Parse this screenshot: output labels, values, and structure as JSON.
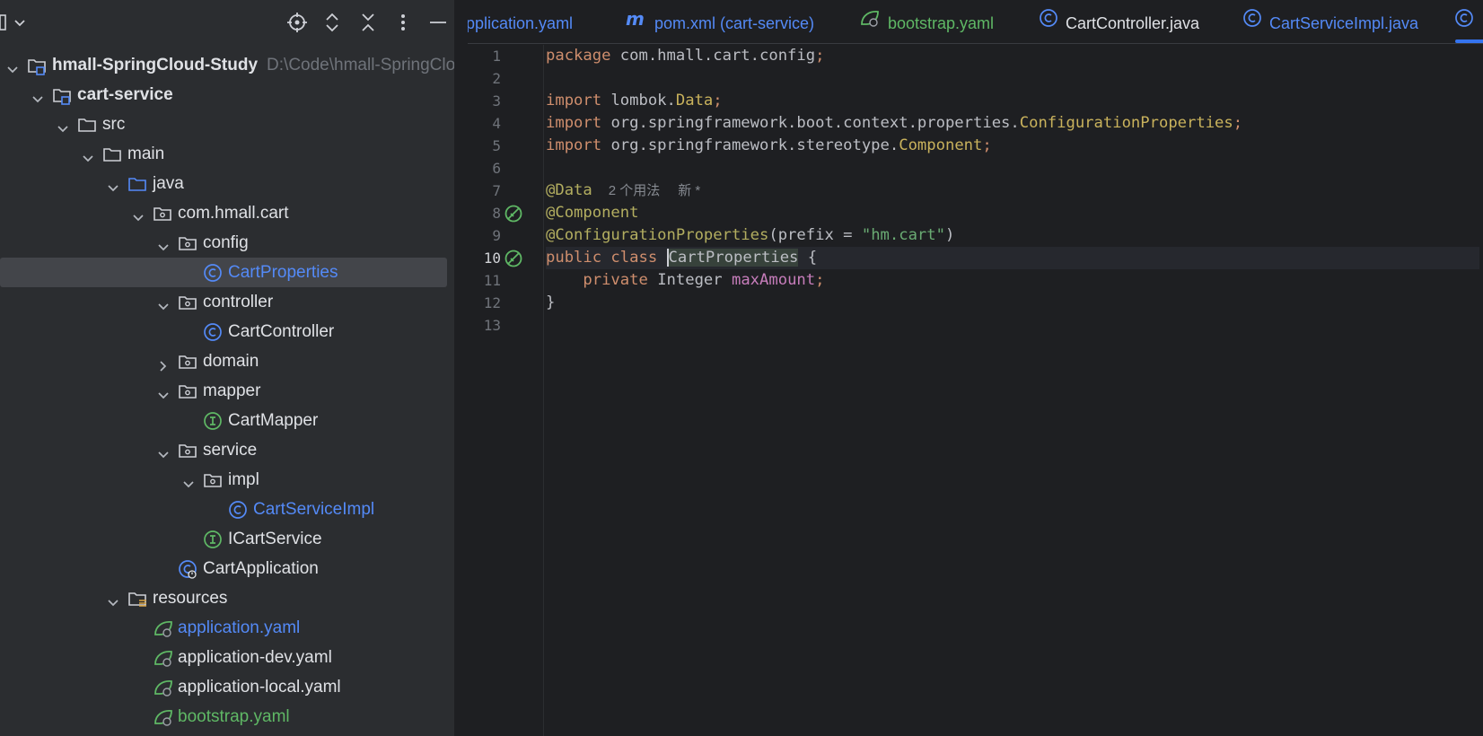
{
  "project_panel": {
    "toolbar_icons": [
      "locate-icon",
      "expand-collapse-icon",
      "collapse-all-icon",
      "more-options-icon",
      "minimize-icon"
    ],
    "tree": [
      {
        "depth": 0,
        "expanded": true,
        "icon": "module-icon",
        "label": "hmall-SpringCloud-Study",
        "path": "D:\\Code\\hmall-SpringCloud",
        "bold": true
      },
      {
        "depth": 1,
        "expanded": true,
        "icon": "module-icon",
        "label": "cart-service",
        "bold": true
      },
      {
        "depth": 2,
        "expanded": true,
        "icon": "folder-icon",
        "label": "src"
      },
      {
        "depth": 3,
        "expanded": true,
        "icon": "folder-icon",
        "label": "main"
      },
      {
        "depth": 4,
        "expanded": true,
        "icon": "source-folder-icon",
        "label": "java"
      },
      {
        "depth": 5,
        "expanded": true,
        "icon": "package-icon",
        "label": "com.hmall.cart"
      },
      {
        "depth": 6,
        "expanded": true,
        "icon": "package-icon",
        "label": "config"
      },
      {
        "depth": 7,
        "icon": "class-icon",
        "label": "CartProperties",
        "color": "blue",
        "selected": true
      },
      {
        "depth": 6,
        "expanded": true,
        "icon": "package-icon",
        "label": "controller"
      },
      {
        "depth": 7,
        "icon": "class-icon",
        "label": "CartController"
      },
      {
        "depth": 6,
        "expanded": false,
        "icon": "package-icon",
        "label": "domain"
      },
      {
        "depth": 6,
        "expanded": true,
        "icon": "package-icon",
        "label": "mapper"
      },
      {
        "depth": 7,
        "icon": "interface-icon",
        "label": "CartMapper"
      },
      {
        "depth": 6,
        "expanded": true,
        "icon": "package-icon",
        "label": "service"
      },
      {
        "depth": 7,
        "expanded": true,
        "icon": "package-icon",
        "label": "impl"
      },
      {
        "depth": 8,
        "icon": "class-icon",
        "label": "CartServiceImpl",
        "color": "blue"
      },
      {
        "depth": 7,
        "icon": "interface-icon",
        "label": "ICartService"
      },
      {
        "depth": 6,
        "icon": "spring-boot-class-icon",
        "label": "CartApplication"
      },
      {
        "depth": 4,
        "expanded": true,
        "icon": "resources-folder-icon",
        "label": "resources"
      },
      {
        "depth": 5,
        "icon": "spring-yaml-icon",
        "label": "application.yaml",
        "color": "blue"
      },
      {
        "depth": 5,
        "icon": "spring-yaml-icon",
        "label": "application-dev.yaml"
      },
      {
        "depth": 5,
        "icon": "spring-yaml-icon",
        "label": "application-local.yaml"
      },
      {
        "depth": 5,
        "icon": "spring-yaml-icon",
        "label": "bootstrap.yaml",
        "color": "green"
      }
    ]
  },
  "editor": {
    "tabs": [
      {
        "label": "application.yaml",
        "visible_text": "pplication.yaml",
        "icon": "",
        "color": "blue"
      },
      {
        "label": "pom.xml (cart-service)",
        "icon": "maven-icon",
        "color": "blue"
      },
      {
        "label": "bootstrap.yaml",
        "icon": "spring-yaml-icon",
        "color": "green"
      },
      {
        "label": "CartController.java",
        "icon": "class-icon",
        "color": "default"
      },
      {
        "label": "CartServiceImpl.java",
        "icon": "class-icon",
        "color": "blue"
      },
      {
        "label": "",
        "icon": "class-icon",
        "active": true
      }
    ],
    "current_line": 10,
    "line_numbers": [
      "1",
      "2",
      "3",
      "4",
      "5",
      "6",
      "7",
      "8",
      "9",
      "10",
      "11",
      "12",
      "13"
    ],
    "gutter_icons": {
      "8": "spring-bean-icon",
      "10": "spring-bean-icon"
    },
    "usage_hint": "2 个用法",
    "new_hint": "新 *",
    "code": {
      "l1": [
        "package",
        " com.hmall.cart.config",
        ";"
      ],
      "l3": [
        "import",
        " lombok.",
        "Data",
        ";"
      ],
      "l4": [
        "import",
        " org.springframework.boot.context.properties.",
        "ConfigurationProperties",
        ";"
      ],
      "l5": [
        "import",
        " org.springframework.stereotype.",
        "Component",
        ";"
      ],
      "l7": [
        "@Data"
      ],
      "l8": [
        "@Component"
      ],
      "l9": [
        "@ConfigurationProperties",
        "(prefix = ",
        "\"hm.cart\"",
        ")"
      ],
      "l10": [
        "public class ",
        "CartProperties",
        " {"
      ],
      "l11": [
        "    private ",
        "Integer ",
        "maxAmount",
        ";"
      ],
      "l12": [
        "}"
      ]
    }
  },
  "colors": {
    "panel_bg": "#2b2d30",
    "editor_bg": "#1e1f22",
    "keyword": "#cf8e6d",
    "annotation": "#b3ae60",
    "string": "#6aab73",
    "field": "#c77dbb",
    "link_blue": "#548af7",
    "green": "#5fb865"
  }
}
